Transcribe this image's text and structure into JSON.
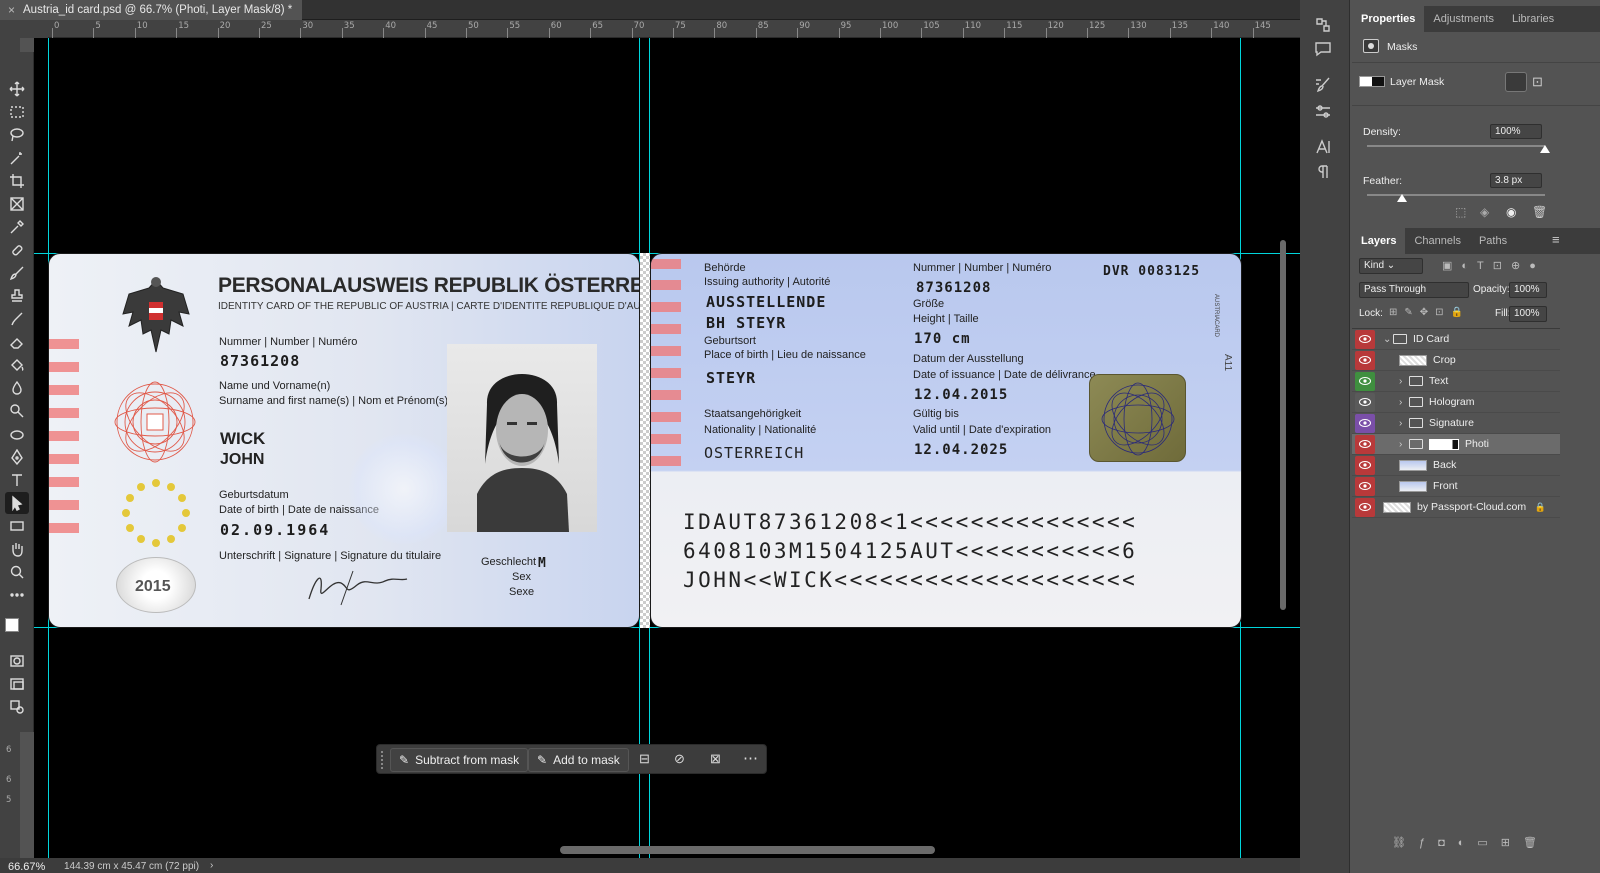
{
  "document": {
    "tab_title": "Austria_id card.psd @ 66.7% (Photi, Layer Mask/8) *",
    "close_icon": "×"
  },
  "ruler": {
    "top_labels": [
      "0",
      "5",
      "10",
      "15",
      "20",
      "25",
      "30",
      "35",
      "40",
      "45",
      "50",
      "55",
      "60",
      "65",
      "70",
      "75",
      "80",
      "85",
      "90",
      "95",
      "100",
      "105",
      "110",
      "115",
      "120",
      "125",
      "130",
      "135",
      "140",
      "145"
    ],
    "left_labels": [
      "6",
      "6",
      "5"
    ]
  },
  "status": {
    "zoom": "66.67%",
    "doc_size": "144.39 cm x 45.47 cm (72 ppi)"
  },
  "context_bar": {
    "subtract": "Subtract from mask",
    "add": "Add to mask",
    "more": "⋯"
  },
  "card_front": {
    "title": "PERSONALAUSWEIS REPUBLIK ÖSTERREICH",
    "subtitle": "IDENTITY CARD OF THE REPUBLIC OF AUSTRIA | CARTE D'IDENTITE REPUBLIQUE D'AUTRICHE",
    "number_label": "Nummer | Number | Numéro",
    "number": "87361208",
    "name_label_1": "Name und Vorname(n)",
    "name_label_2": "Surname and first name(s) | Nom et Prénom(s)",
    "surname": "WICK",
    "given_name": "JOHN",
    "dob_label_1": "Geburtsdatum",
    "dob_label_2": "Date of birth | Date de naissance",
    "dob": "02.09.1964",
    "signature_label": "Unterschrift | Signature | Signature du titulaire",
    "sex_label_1": "Geschlecht",
    "sex_label_2": "Sex",
    "sex_label_3": "Sexe",
    "sex": "M",
    "coin_year": "2015"
  },
  "card_back": {
    "authority_label_1": "Behörde",
    "authority_label_2": "Issuing authority | Autorité",
    "authority_1": "AUSSTELLENDE",
    "authority_2": "BH STEYR",
    "place_label_1": "Geburtsort",
    "place_label_2": "Place of birth | Lieu de naissance",
    "place": "STEYR",
    "nationality_label_1": "Staatsangehörigkeit",
    "nationality_label_2": "Nationality | Nationalité",
    "nationality": "OSTERREICH",
    "number_label": "Nummer | Number | Numéro",
    "number": "87361208",
    "dvr": "DVR 0083125",
    "height_label_1": "Größe",
    "height_label_2": "Height | Taille",
    "height": "170 cm",
    "issue_label_1": "Datum der Ausstellung",
    "issue_label_2": "Date of issuance | Date de délivrance",
    "issue_date": "12.04.2015",
    "valid_label_1": "Gültig bis",
    "valid_label_2": "Valid until | Date d'expiration",
    "valid_date": "12.04.2025",
    "side_text_1": "AUSTRIACARD",
    "side_text_2": "A11",
    "mrz_1": "IDAUT87361208<1<<<<<<<<<<<<<<<",
    "mrz_2": "6408103M1504125AUT<<<<<<<<<<<6",
    "mrz_3": "JOHN<<WICK<<<<<<<<<<<<<<<<<<<<"
  },
  "properties": {
    "tabs": [
      "Properties",
      "Adjustments",
      "Libraries"
    ],
    "masks_label": "Masks",
    "layer_mask_label": "Layer Mask",
    "density_label": "Density:",
    "density_value": "100%",
    "density_level": 1.0,
    "feather_label": "Feather:",
    "feather_value": "3.8 px"
  },
  "layers": {
    "tabs": [
      "Layers",
      "Channels",
      "Paths"
    ],
    "filter": "Kind",
    "blend_mode": "Pass Through",
    "opacity_label": "Opacity:",
    "opacity_value": "100%",
    "lock_label": "Lock:",
    "fill_label": "Fill:",
    "fill_value": "100%",
    "items": [
      {
        "name": "ID Card",
        "kind": "group",
        "eye_color": "#b8393a"
      },
      {
        "name": "Crop",
        "kind": "layer",
        "eye_color": "#b8393a"
      },
      {
        "name": "Text",
        "kind": "group",
        "eye_color": "#3f8f3f"
      },
      {
        "name": "Hologram",
        "kind": "group",
        "eye_color": "#5a5a5a"
      },
      {
        "name": "Signature",
        "kind": "group",
        "eye_color": "#7a4fa8"
      },
      {
        "name": "Photi",
        "kind": "group",
        "eye_color": "#b8393a"
      },
      {
        "name": "Back",
        "kind": "layer",
        "eye_color": "#b8393a"
      },
      {
        "name": "Front",
        "kind": "layer",
        "eye_color": "#b8393a"
      },
      {
        "name": "by Passport-Cloud.com",
        "kind": "layer",
        "eye_color": "#b8393a"
      }
    ]
  },
  "colors": {
    "guide": "#00d5dc",
    "stripe": "#ef7b7b",
    "panel": "#535353"
  }
}
